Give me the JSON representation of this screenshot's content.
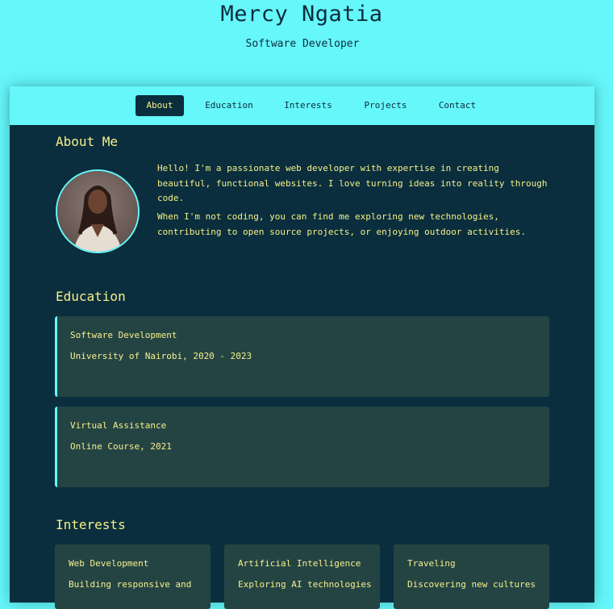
{
  "header": {
    "name": "Mercy Ngatia",
    "role": "Software Developer"
  },
  "nav": {
    "items": [
      {
        "label": "About",
        "active": true
      },
      {
        "label": "Education",
        "active": false
      },
      {
        "label": "Interests",
        "active": false
      },
      {
        "label": "Projects",
        "active": false
      },
      {
        "label": "Contact",
        "active": false
      }
    ]
  },
  "about": {
    "title": "About Me",
    "paragraphs": [
      "Hello! I'm a passionate web developer with expertise in creating beautiful, functional websites. I love turning ideas into reality through code.",
      "When I'm not coding, you can find me exploring new technologies, contributing to open source projects, or enjoying outdoor activities."
    ]
  },
  "education": {
    "title": "Education",
    "items": [
      {
        "name": "Software Development",
        "detail": "University of Nairobi, 2020 - 2023"
      },
      {
        "name": "Virtual Assistance",
        "detail": "Online Course, 2021"
      }
    ]
  },
  "interests": {
    "title": "Interests",
    "items": [
      {
        "name": "Web Development",
        "desc": "Building responsive and"
      },
      {
        "name": "Artificial Intelligence",
        "desc": "Exploring AI technologies"
      },
      {
        "name": "Traveling",
        "desc": "Discovering new cultures"
      }
    ]
  },
  "colors": {
    "page_bg": "#66f7fa",
    "panel_bg": "#0a2e3d",
    "card_bg": "#244444",
    "accent_text": "#f6f08a",
    "accent_border": "#66f7fa"
  },
  "icons": {
    "avatar": "profile-photo"
  }
}
